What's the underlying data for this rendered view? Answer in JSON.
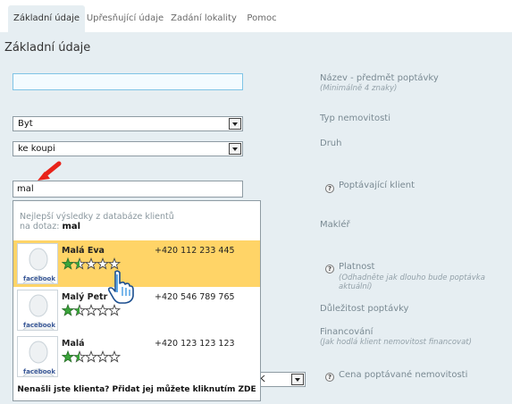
{
  "tabs": [
    {
      "label": "Základní údaje"
    },
    {
      "label": "Upřesňující údaje"
    },
    {
      "label": "Zadání lokality"
    },
    {
      "label": "Pomoc"
    }
  ],
  "section_title": "Základní údaje",
  "fields": {
    "title_input": {
      "value": ""
    },
    "property_type": {
      "value": "Byt"
    },
    "kind": {
      "value": "ke koupi"
    },
    "client_search": {
      "value": "mal"
    },
    "price_select": {
      "value": "K"
    }
  },
  "labels": {
    "title": "Název - předmět poptávky",
    "title_hint": "(Minimálně 4 znaky)",
    "property_type": "Typ nemovitosti",
    "kind": "Druh",
    "client": "Poptávající klient",
    "broker": "Makléř",
    "validity": "Platnost",
    "validity_hint": "(Odhadněte jak dlouho bude poptávka aktuální)",
    "importance": "Důležitost poptávky",
    "financing": "Financování",
    "financing_hint": "(Jak hodlá klient nemovitost financovat)",
    "price": "Cena poptávané nemovitosti",
    "help_symbol": "?"
  },
  "dropdown": {
    "header_line1": "Nejlepší výsledky z databáze klientů",
    "header_prefix": "na dotaz:",
    "query": "mal",
    "footer": "Nenašli jste klienta? Přidat jej můžete kliknutím ZDE",
    "avatar_brand": "facebook",
    "results": [
      {
        "name": "Malá Eva",
        "phone": "+420 112 233 445",
        "rating": 1.5,
        "highlighted": true
      },
      {
        "name": "Malý Petr",
        "phone": "+420 546 789 765",
        "rating": 1.5,
        "highlighted": false
      },
      {
        "name": "Malá",
        "phone": "+420 123 123 123",
        "rating": 1.5,
        "highlighted": false
      }
    ]
  },
  "colors": {
    "panel_bg": "#e6eef2",
    "highlight": "#ffd467",
    "star_filled": "#3aa53a",
    "arrow_red": "#e8231a"
  }
}
